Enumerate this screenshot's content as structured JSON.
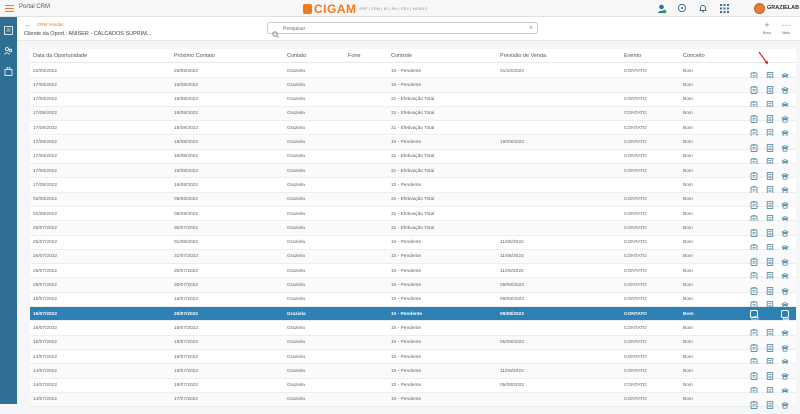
{
  "app": {
    "portal_title": "Portal CRM",
    "logo_text": "CIGAM",
    "logo_tagline": "ERP | CRM | BI | RH | PDV | MOBILE",
    "user_name": "GRAZIELAB"
  },
  "header": {
    "crumb_parent": "CRM Vendas",
    "crumb_current": "Cliente da Oport.: ANISER - CALCADOS SUPRIM...",
    "search_placeholder": "Pesquisar",
    "new_label": "Novo",
    "more_label": "Mais"
  },
  "table": {
    "columns": [
      "Data da Oportunidade",
      "Próximo Contato",
      "Contato",
      "Fone",
      "Controle",
      "Previsão de Venda",
      "Evento",
      "Conceito"
    ],
    "rows": [
      [
        "22/09/2022",
        "25/09/2022",
        "Graziela",
        "",
        "10 - Pendente",
        "31/10/2022",
        "CONTATO",
        "Bom"
      ],
      [
        "17/08/2022",
        "18/08/2022",
        "Graziela",
        "",
        "10 - Pendente",
        "",
        "",
        "Bom"
      ],
      [
        "17/08/2022",
        "18/08/2022",
        "Graziela",
        "",
        "31 - Efetivação Total",
        "",
        "CONTATO",
        "Bom"
      ],
      [
        "17/08/2022",
        "18/08/2022",
        "Graziela",
        "",
        "31 - Efetivação Total",
        "",
        "CONTATO",
        "Bom"
      ],
      [
        "17/08/2022",
        "18/08/2022",
        "Graziela",
        "",
        "31 - Efetivação Total",
        "",
        "CONTATO",
        "Bom"
      ],
      [
        "17/08/2022",
        "18/08/2022",
        "Graziela",
        "",
        "10 - Pendente",
        "19/08/2022",
        "CONTATO",
        "Bom"
      ],
      [
        "17/08/2022",
        "18/08/2022",
        "Graziela",
        "",
        "31 - Efetivação Total",
        "",
        "CONTATO",
        "Bom"
      ],
      [
        "17/08/2022",
        "18/08/2022",
        "Graziela",
        "",
        "31 - Efetivação Total",
        "",
        "CONTATO",
        "Bom"
      ],
      [
        "17/08/2022",
        "18/08/2022",
        "Graziela",
        "",
        "10 - Pendente",
        "",
        "",
        "Bom"
      ],
      [
        "02/08/2022",
        "09/08/2022",
        "Graziela",
        "",
        "31 - Efetivação Total",
        "",
        "CONTATO",
        "Bom"
      ],
      [
        "01/08/2022",
        "05/08/2022",
        "Graziela",
        "",
        "31 - Efetivação Total",
        "",
        "CONTATO",
        "Bom"
      ],
      [
        "25/07/2022",
        "30/07/2022",
        "Graziela",
        "",
        "31 - Efetivação Total",
        "",
        "CONTATO",
        "Bom"
      ],
      [
        "25/07/2022",
        "01/08/2022",
        "Graziela",
        "",
        "10 - Pendente",
        "11/08/2022",
        "CONTATO",
        "Bom"
      ],
      [
        "25/07/2022",
        "31/07/2022",
        "Graziela",
        "",
        "10 - Pendente",
        "11/08/2022",
        "CONTATO",
        "Bom"
      ],
      [
        "25/07/2022",
        "30/07/2022",
        "Graziela",
        "",
        "10 - Pendente",
        "11/08/2022",
        "CONTATO",
        "Bom"
      ],
      [
        "25/07/2022",
        "30/07/2022",
        "Graziela",
        "",
        "10 - Pendente",
        "09/08/2022",
        "CONTATO",
        "Bom"
      ],
      [
        "15/07/2022",
        "16/07/2022",
        "Graziela",
        "",
        "10 - Pendente",
        "09/08/2022",
        "CONTATO",
        "Bom"
      ],
      [
        "15/07/2022",
        "20/07/2022",
        "Graziela",
        "",
        "10 - Pendente",
        "09/08/2022",
        "CONTATO",
        "Bom"
      ],
      [
        "15/07/2022",
        "16/07/2022",
        "Graziela",
        "",
        "10 - Pendente",
        "",
        "CONTATO",
        "Bom"
      ],
      [
        "15/07/2022",
        "15/07/2022",
        "Graziela",
        "",
        "10 - Pendente",
        "05/08/2022",
        "CONTATO",
        "Bom"
      ],
      [
        "14/07/2022",
        "16/07/2022",
        "Graziela",
        "",
        "10 - Pendente",
        "",
        "CONTATO",
        "Bom"
      ],
      [
        "14/07/2022",
        "15/07/2022",
        "Graziela",
        "",
        "10 - Pendente",
        "11/08/2022",
        "CONTATO",
        "Bom"
      ],
      [
        "14/07/2022",
        "18/07/2022",
        "Graziela",
        "",
        "10 - Pendente",
        "05/08/2022",
        "CONTATO",
        "Bom"
      ],
      [
        "14/07/2022",
        "17/07/2022",
        "Graziela",
        "",
        "10 - Pendente",
        "",
        "CONTATO",
        "Bom"
      ]
    ],
    "selected_row_index": 17
  },
  "colors": {
    "accent": "#f47920",
    "sidebar": "#2e6f93",
    "selected_row": "#2e81b5",
    "arrow": "#e02020"
  },
  "icons": {
    "row_actions": [
      "clipboard-icon",
      "document-icon",
      "phone-icon"
    ]
  }
}
